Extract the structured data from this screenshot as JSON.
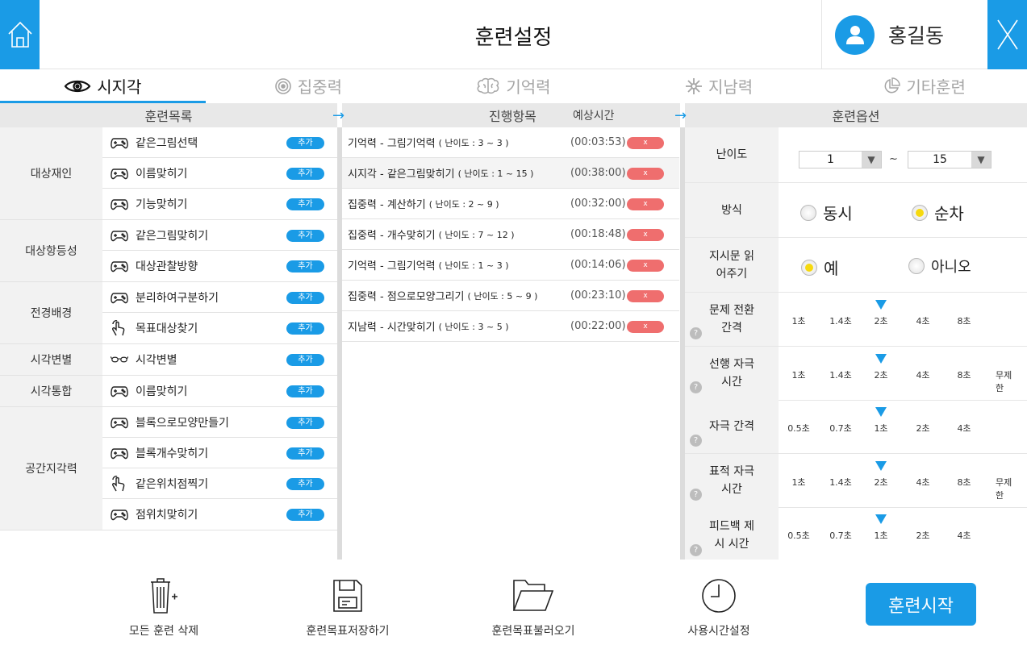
{
  "header": {
    "title": "훈련설정",
    "user_name": "홍길동",
    "home_icon": "home-icon",
    "close_icon": "close-icon",
    "accent": "#1a9be6"
  },
  "tabs": [
    {
      "label": "시지각",
      "icon": "eye-icon",
      "active": true
    },
    {
      "label": "집중력",
      "icon": "target-icon",
      "active": false
    },
    {
      "label": "기억력",
      "icon": "brain-icon",
      "active": false
    },
    {
      "label": "지남력",
      "icon": "compass-icon",
      "active": false
    },
    {
      "label": "기타훈련",
      "icon": "pie-icon",
      "active": false
    }
  ],
  "columns": {
    "list_header": "훈련목록",
    "progress_header": "진행항목",
    "progress_time_header": "예상시간",
    "options_header": "훈련옵션",
    "arrow": "→"
  },
  "training_groups": [
    {
      "label": "대상재인",
      "items": [
        {
          "label": "같은그림선택",
          "add": "추가",
          "icon": "gamepad-icon"
        },
        {
          "label": "이름맞히기",
          "add": "추가",
          "icon": "gamepad-icon"
        },
        {
          "label": "기능맞히기",
          "add": "추가",
          "icon": "gamepad-icon"
        }
      ]
    },
    {
      "label": "대상항등성",
      "items": [
        {
          "label": "같은그림맞히기",
          "add": "추가",
          "icon": "gamepad-icon"
        },
        {
          "label": "대상관찰방향",
          "add": "추가",
          "icon": "gamepad-icon"
        }
      ]
    },
    {
      "label": "전경배경",
      "items": [
        {
          "label": "분리하여구분하기",
          "add": "추가",
          "icon": "gamepad-icon"
        },
        {
          "label": "목표대상찾기",
          "add": "추가",
          "icon": "touch-icon"
        }
      ]
    },
    {
      "label": "시각변별",
      "items": [
        {
          "label": "시각변별",
          "add": "추가",
          "icon": "glasses-icon"
        }
      ]
    },
    {
      "label": "시각통합",
      "items": [
        {
          "label": "이름맞히기",
          "add": "추가",
          "icon": "gamepad-icon"
        }
      ]
    },
    {
      "label": "공간지각력",
      "items": [
        {
          "label": "블록으로모양만들기",
          "add": "추가",
          "icon": "gamepad-icon"
        },
        {
          "label": "블록개수맞히기",
          "add": "추가",
          "icon": "gamepad-icon"
        },
        {
          "label": "같은위치점찍기",
          "add": "추가",
          "icon": "touch-icon"
        },
        {
          "label": "점위치맞히기",
          "add": "추가",
          "icon": "gamepad-icon"
        }
      ]
    }
  ],
  "progress_items": [
    {
      "name": "기억력 - 그림기억력",
      "difficulty": "( 난이도 : 3 ~ 3 )",
      "time": "(00:03:53)",
      "delete": "x"
    },
    {
      "name": "시지각 - 같은그림맞히기",
      "difficulty": "( 난이도 : 1 ~ 15 )",
      "time": "(00:38:00)",
      "delete": "x"
    },
    {
      "name": "집중력 - 계산하기",
      "difficulty": "( 난이도 : 2 ~ 9 )",
      "time": "(00:32:00)",
      "delete": "x"
    },
    {
      "name": "집중력 - 개수맞히기",
      "difficulty": "( 난이도 : 7 ~ 12 )",
      "time": "(00:18:48)",
      "delete": "x"
    },
    {
      "name": "기억력 - 그림기억력",
      "difficulty": "( 난이도 : 1 ~ 3 )",
      "time": "(00:14:06)",
      "delete": "x"
    },
    {
      "name": "집중력 - 점으로모양그리기",
      "difficulty": "( 난이도 : 5 ~ 9 )",
      "time": "(00:23:10)",
      "delete": "x"
    },
    {
      "name": "지남력 - 시간맞히기",
      "difficulty": "( 난이도 : 3 ~ 5 )",
      "time": "(00:22:00)",
      "delete": "x"
    }
  ],
  "options": {
    "difficulty": {
      "label": "난이도",
      "from": "1",
      "to": "15",
      "tilde": "~"
    },
    "mode": {
      "label": "방식",
      "choices": [
        "동시",
        "순차"
      ],
      "selected": 1
    },
    "read_aloud": {
      "label": "지시문 읽어주기",
      "choices": [
        "예",
        "아니오"
      ],
      "selected": 0
    },
    "help_glyph": "?",
    "scales": [
      {
        "label": "문제 전환 간격",
        "ticks": [
          "1초",
          "1.4초",
          "2초",
          "4초",
          "8초"
        ],
        "selected": 2
      },
      {
        "label": "선행 자극 시간",
        "ticks": [
          "1초",
          "1.4초",
          "2초",
          "4초",
          "8초",
          "무제한"
        ],
        "selected": 2
      },
      {
        "label": "자극 간격",
        "ticks": [
          "0.5초",
          "0.7초",
          "1초",
          "2초",
          "4초"
        ],
        "selected": 2
      },
      {
        "label": "표적 자극 시간",
        "ticks": [
          "1초",
          "1.4초",
          "2초",
          "4초",
          "8초",
          "무제한"
        ],
        "selected": 2
      },
      {
        "label": "피드백 제시 시간",
        "ticks": [
          "0.5초",
          "0.7초",
          "1초",
          "2초",
          "4초"
        ],
        "selected": 2
      }
    ]
  },
  "toolbar": {
    "delete_all": "모든 훈련 삭제",
    "save_target": "훈련목표저장하기",
    "load_target": "훈련목표불러오기",
    "time_setting": "사용시간설정",
    "start": "훈련시작"
  }
}
